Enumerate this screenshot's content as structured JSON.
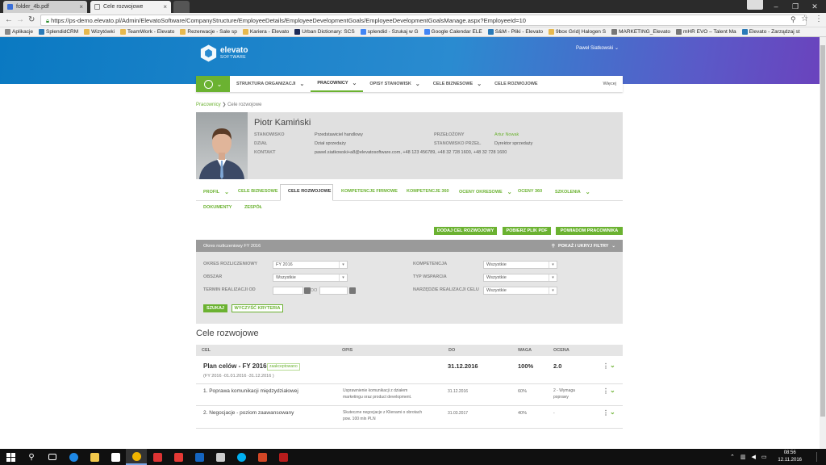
{
  "browser": {
    "tabs": [
      {
        "label": "folder_4b.pdf"
      },
      {
        "label": "Cele rozwojowe"
      }
    ],
    "url": "https://ps-demo.elevato.pl/Admin/ElevatoSoftware/CompanyStructure/EmployeeDetails/EmployeeDevelopmentGoals/EmployeeDevelopmentGoalsManage.aspx?EmployeeId=10",
    "bookmarks": [
      {
        "label": "Aplikacje",
        "color": "#888888"
      },
      {
        "label": "SplendidCRM",
        "color": "#2a7ab8"
      },
      {
        "label": "Wizytówki",
        "color": "#e6b84f"
      },
      {
        "label": "TeamWork - Elevato",
        "color": "#e6b84f"
      },
      {
        "label": "Rezerwacje - Sale sp",
        "color": "#e6b84f"
      },
      {
        "label": "Kariera - Elevato",
        "color": "#e6b84f"
      },
      {
        "label": "Urban Dictionary: SCS",
        "color": "#1d2a57"
      },
      {
        "label": "splendid - Szukaj w G",
        "color": "#4285f4"
      },
      {
        "label": "Google Calendar ELE",
        "color": "#4285f4"
      },
      {
        "label": "S&M - Pliki - Elevato",
        "color": "#2a7ab8"
      },
      {
        "label": "9box Grid| Halogen S",
        "color": "#e6b84f"
      },
      {
        "label": "MARKETING_Elevato",
        "color": "#777777"
      },
      {
        "label": "mHR EVO – Talent Ma",
        "color": "#777777"
      },
      {
        "label": "Elevato - Zarządzaj st",
        "color": "#2a7ab8"
      }
    ]
  },
  "app": {
    "logo_name": "elevato",
    "logo_sub": "SOFTWARE",
    "user": "Paweł Siatkowski ⌄",
    "nav": [
      {
        "label": "STRUKTURA ORGANIZACJI",
        "chevron": true
      },
      {
        "label": "PRACOWNICY",
        "chevron": true,
        "active": true
      },
      {
        "label": "OPISY STANOWISK",
        "chevron": true
      },
      {
        "label": "CELE BIZNESOWE",
        "chevron": true
      },
      {
        "label": "CELE ROZWOJOWE",
        "chevron": false
      }
    ],
    "nav_more": "Więcej",
    "breadcrumb": {
      "link": "Pracownicy",
      "current": "Cele rozwojowe"
    },
    "profile": {
      "name": "Piotr Kamiński",
      "labels": {
        "position": "STANOWISKO",
        "department": "DZIAŁ",
        "contact": "KONTAKT",
        "manager": "PRZEŁOŻONY",
        "manager_position": "STANOWISKO PRZEŁ."
      },
      "position": "Przedstawiciel handlowy",
      "department": "Dział sprzedaży",
      "contact": "pawel.siatkowski+a8@elevatosoftware.com, +48 123 456789, +48 32 728 1600, +48 32 728 1600",
      "manager": "Artur Nowak",
      "manager_position": "Dyrektor sprzedaży"
    },
    "tabs": [
      {
        "label": "PROFIL",
        "chevron": true
      },
      {
        "label": "CELE BIZNESOWE",
        "chevron": false
      },
      {
        "label": "CELE ROZWOJOWE",
        "chevron": false,
        "active": true
      },
      {
        "label": "KOMPETENCJE FIRMOWE",
        "chevron": false
      },
      {
        "label": "KOMPETENCJE 360",
        "chevron": false
      },
      {
        "label": "OCENY OKRESOWE",
        "chevron": true
      },
      {
        "label": "OCENY 360",
        "chevron": false
      },
      {
        "label": "SZKOLENIA",
        "chevron": true
      },
      {
        "label": "DOKUMENTY",
        "chevron": false
      },
      {
        "label": "ZESPÓŁ",
        "chevron": false
      }
    ],
    "actions": {
      "add_goal": "DODAJ CEL ROZWOJOWY",
      "download_pdf": "POBIERZ PLIK PDF",
      "notify": "POWIADOM PRACOWNIKA"
    },
    "filter": {
      "period_title": "Okres rozliczeniowy FY 2016",
      "toggle": "POKAŻ / UKRYJ FILTRY",
      "labels": {
        "period": "OKRES ROZLICZENIOWY",
        "area": "OBSZAR",
        "deadline_from": "TERMIN REALIZACJI OD",
        "to": "DO",
        "competence": "KOMPETENCJA",
        "support": "TYP WSPARCIA",
        "tool": "NARZĘDZIE REALIZACJI CELU"
      },
      "values": {
        "period": "FY 2016",
        "area": "Wszystkie",
        "competence": "Wszystkie",
        "support": "Wszystkie",
        "tool": "Wszystkie"
      },
      "search": "SZUKAJ",
      "clear": "WYCZYŚĆ KRYTERIA"
    },
    "goals": {
      "title": "Cele rozwojowe",
      "columns": [
        "CEL",
        "OPIS",
        "DO",
        "WAGA",
        "OCENA"
      ],
      "plan": {
        "name": "Plan celów - FY 2016",
        "badge": "zaakceptowano",
        "period": "(FY 2016 -01.01.2016 -31.12.2016 )",
        "date": "31.12.2016",
        "weight": "100%",
        "grade": "2.0"
      },
      "rows": [
        {
          "goal": "1. Poprawa komunikacji międzydziałowej",
          "desc1": "Usprawnienie komunikacji z działem",
          "desc2": "marketingu oraz product development.",
          "date": "31.12.2016",
          "weight": "60%",
          "grade1": "2 - Wymaga",
          "grade2": "poprawy"
        },
        {
          "goal": "2. Negocjacje - poziom zaawansowany",
          "desc1": "Skuteczne negocjacje z Klienami o obrotach",
          "desc2": "pow. 100 mln PLN",
          "date": "31.03.2017",
          "weight": "40%",
          "grade1": "-",
          "grade2": ""
        }
      ]
    }
  },
  "taskbar": {
    "time": "08:56",
    "date": "12.11.2016"
  }
}
